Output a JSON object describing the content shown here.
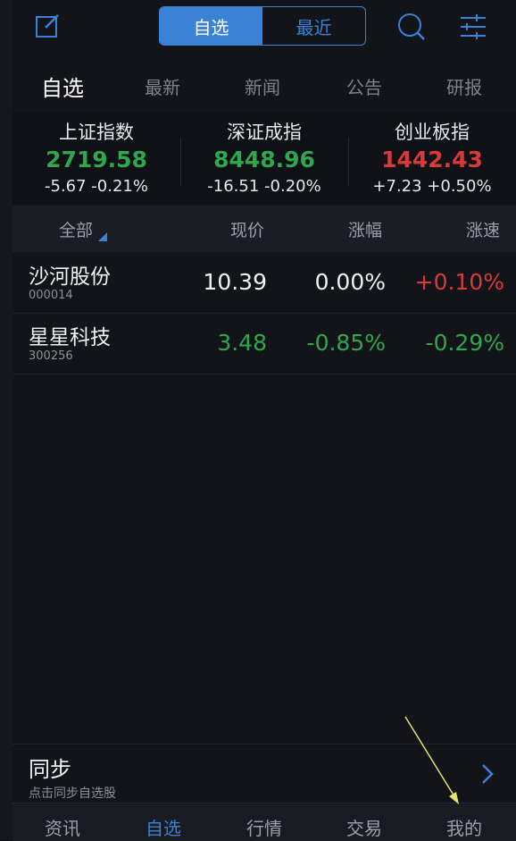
{
  "topbar": {
    "segment": {
      "selected": "自选",
      "other": "最近"
    },
    "icons": [
      "edit-icon",
      "search-icon",
      "settings-sliders-icon"
    ]
  },
  "tabs": [
    "自选",
    "最新",
    "新闻",
    "公告",
    "研报"
  ],
  "indices": [
    {
      "name": "上证指数",
      "value": "2719.58",
      "change": "-5.67  -0.21%",
      "trend": "down"
    },
    {
      "name": "深证成指",
      "value": "8448.96",
      "change": "-16.51  -0.20%",
      "trend": "down"
    },
    {
      "name": "创业板指",
      "value": "1442.43",
      "change": "+7.23  +0.50%",
      "trend": "up"
    }
  ],
  "columns": {
    "all": "全部",
    "price": "现价",
    "change": "涨幅",
    "speed": "涨速"
  },
  "stocks": [
    {
      "name": "沙河股份",
      "code": "000014",
      "price": "10.39",
      "change": "0.00%",
      "speed": "+0.10%"
    },
    {
      "name": "星星科技",
      "code": "300256",
      "price": "3.48",
      "change": "-0.85%",
      "speed": "-0.29%"
    }
  ],
  "sync": {
    "title": "同步",
    "subtitle": "点击同步自选股"
  },
  "bottom_nav": [
    {
      "label": "资讯"
    },
    {
      "label": "自选",
      "active": true
    },
    {
      "label": "行情"
    },
    {
      "label": "交易"
    },
    {
      "label": "我的"
    }
  ],
  "colors": {
    "accent": "#3a82d6",
    "up": "#d83a3a",
    "down": "#2ea84d"
  }
}
